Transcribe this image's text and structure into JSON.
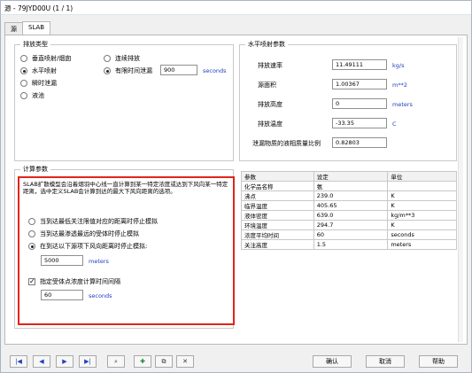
{
  "window": {
    "title": "源 - 79JYD00U (1 / 1)"
  },
  "tabs": [
    {
      "label": "源"
    },
    {
      "label": "SLAB"
    }
  ],
  "release_type": {
    "legend": "排放类型",
    "options": [
      {
        "label": "垂直喷射/烟囱",
        "selected": false
      },
      {
        "label": "水平喷射",
        "selected": true
      },
      {
        "label": "瞬时泄漏",
        "selected": false
      },
      {
        "label": "液池",
        "selected": false
      },
      {
        "label": "连续排放",
        "selected": false
      },
      {
        "label": "有限时间泄漏",
        "selected": true
      }
    ],
    "duration_value": "900",
    "duration_unit": "seconds"
  },
  "horizontal_jet": {
    "legend": "水平喷射参数",
    "rows": [
      {
        "label": "排放速率",
        "value": "11.49111",
        "unit": "kg/s"
      },
      {
        "label": "源面积",
        "value": "1.00367",
        "unit": "m**2"
      },
      {
        "label": "排放高度",
        "value": "0",
        "unit": "meters"
      },
      {
        "label": "排放温度",
        "value": "-33.35",
        "unit": "C"
      },
      {
        "label": "泄漏物质的液相质量比例",
        "value": "0.82803",
        "unit": ""
      }
    ]
  },
  "calc_params": {
    "legend": "计算参数",
    "description": "SLAB扩散模型会沿着烟羽中心线一直计算到某一特定浓度或达到下风向某一特定距离，选中定义SLAB会计算到达的最大下风向距离的选项。",
    "options": [
      {
        "label": "当到达最低关注限值对应的距离时停止模拟",
        "selected": false
      },
      {
        "label": "当到达最渗透最远的受体时停止模拟",
        "selected": false
      },
      {
        "label": "在到达以下源项下风向距离时停止模拟:",
        "selected": true
      }
    ],
    "distance_value": "5000",
    "distance_unit": "meters",
    "checkbox_label": "指定受体点浓度计算时间间隔",
    "checkbox_checked": true,
    "interval_value": "60",
    "interval_unit": "seconds"
  },
  "property_table": {
    "headers": [
      "参数",
      "设定",
      "单位"
    ],
    "rows": [
      [
        "化学品名称",
        "氨",
        ""
      ],
      [
        "沸点",
        "239.0",
        "K"
      ],
      [
        "临界温度",
        "405.65",
        "K"
      ],
      [
        "液体密度",
        "639.0",
        "kg/m**3"
      ],
      [
        "环境温度",
        "294.7",
        "K"
      ],
      [
        "浓度平均时间",
        "60",
        "seconds"
      ],
      [
        "关注高度",
        "1.5",
        "meters"
      ]
    ]
  },
  "buttons": {
    "ok": "确认",
    "cancel": "取消",
    "help": "帮助"
  },
  "colors": {
    "highlight_border": "#e1251b",
    "unit_text": "#1f3ebf"
  }
}
